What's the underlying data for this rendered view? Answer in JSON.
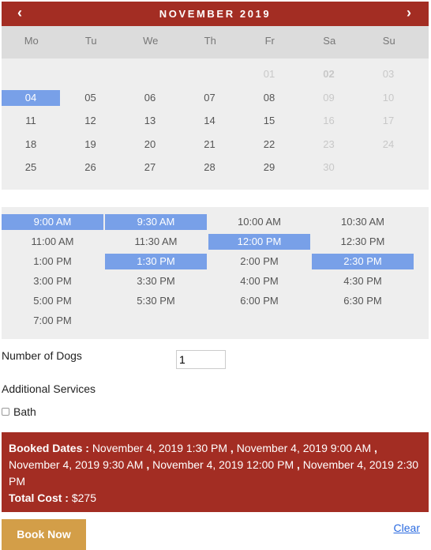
{
  "calendar": {
    "title": "NOVEMBER 2019",
    "prev_icon": "‹",
    "next_icon": "›",
    "weekdays": [
      "Mo",
      "Tu",
      "We",
      "Th",
      "Fr",
      "Sa",
      "Su"
    ],
    "days": [
      {
        "label": "01",
        "col": 4,
        "row": 0,
        "state": "disabled"
      },
      {
        "label": "02",
        "col": 5,
        "row": 0,
        "state": "disabled-bold"
      },
      {
        "label": "03",
        "col": 6,
        "row": 0,
        "state": "disabled"
      },
      {
        "label": "04",
        "col": 0,
        "row": 1,
        "state": "selected"
      },
      {
        "label": "05",
        "col": 1,
        "row": 1,
        "state": "normal"
      },
      {
        "label": "06",
        "col": 2,
        "row": 1,
        "state": "normal"
      },
      {
        "label": "07",
        "col": 3,
        "row": 1,
        "state": "normal"
      },
      {
        "label": "08",
        "col": 4,
        "row": 1,
        "state": "normal"
      },
      {
        "label": "09",
        "col": 5,
        "row": 1,
        "state": "disabled"
      },
      {
        "label": "10",
        "col": 6,
        "row": 1,
        "state": "disabled"
      },
      {
        "label": "11",
        "col": 0,
        "row": 2,
        "state": "normal"
      },
      {
        "label": "12",
        "col": 1,
        "row": 2,
        "state": "normal"
      },
      {
        "label": "13",
        "col": 2,
        "row": 2,
        "state": "normal"
      },
      {
        "label": "14",
        "col": 3,
        "row": 2,
        "state": "normal"
      },
      {
        "label": "15",
        "col": 4,
        "row": 2,
        "state": "normal"
      },
      {
        "label": "16",
        "col": 5,
        "row": 2,
        "state": "disabled"
      },
      {
        "label": "17",
        "col": 6,
        "row": 2,
        "state": "disabled"
      },
      {
        "label": "18",
        "col": 0,
        "row": 3,
        "state": "normal"
      },
      {
        "label": "19",
        "col": 1,
        "row": 3,
        "state": "normal"
      },
      {
        "label": "20",
        "col": 2,
        "row": 3,
        "state": "normal"
      },
      {
        "label": "21",
        "col": 3,
        "row": 3,
        "state": "normal"
      },
      {
        "label": "22",
        "col": 4,
        "row": 3,
        "state": "normal"
      },
      {
        "label": "23",
        "col": 5,
        "row": 3,
        "state": "disabled"
      },
      {
        "label": "24",
        "col": 6,
        "row": 3,
        "state": "disabled"
      },
      {
        "label": "25",
        "col": 0,
        "row": 4,
        "state": "normal"
      },
      {
        "label": "26",
        "col": 1,
        "row": 4,
        "state": "normal"
      },
      {
        "label": "27",
        "col": 2,
        "row": 4,
        "state": "normal"
      },
      {
        "label": "28",
        "col": 3,
        "row": 4,
        "state": "normal"
      },
      {
        "label": "29",
        "col": 4,
        "row": 4,
        "state": "normal"
      },
      {
        "label": "30",
        "col": 5,
        "row": 4,
        "state": "disabled"
      }
    ]
  },
  "time_slots": [
    {
      "label": "9:00 AM",
      "selected": true
    },
    {
      "label": "9:30 AM",
      "selected": true
    },
    {
      "label": "10:00 AM",
      "selected": false
    },
    {
      "label": "10:30 AM",
      "selected": false
    },
    {
      "label": "11:00 AM",
      "selected": false
    },
    {
      "label": "11:30 AM",
      "selected": false
    },
    {
      "label": "12:00 PM",
      "selected": true
    },
    {
      "label": "12:30 PM",
      "selected": false
    },
    {
      "label": "1:00 PM",
      "selected": false
    },
    {
      "label": "1:30 PM",
      "selected": true
    },
    {
      "label": "2:00 PM",
      "selected": false
    },
    {
      "label": "2:30 PM",
      "selected": true
    },
    {
      "label": "3:00 PM",
      "selected": false
    },
    {
      "label": "3:30 PM",
      "selected": false
    },
    {
      "label": "4:00 PM",
      "selected": false
    },
    {
      "label": "4:30 PM",
      "selected": false
    },
    {
      "label": "5:00 PM",
      "selected": false
    },
    {
      "label": "5:30 PM",
      "selected": false
    },
    {
      "label": "6:00 PM",
      "selected": false
    },
    {
      "label": "6:30 PM",
      "selected": false
    },
    {
      "label": "7:00 PM",
      "selected": false
    }
  ],
  "form": {
    "dogs_label": "Number of Dogs",
    "dogs_value": "1",
    "services_label": "Additional Services",
    "bath_label": "Bath",
    "bath_checked": false
  },
  "summary": {
    "booked_label": "Booked Dates :",
    "booked_dates": [
      "November 4, 2019 1:30 PM",
      "November 4, 2019 9:00 AM",
      "November 4, 2019 9:30 AM",
      "November 4, 2019 12:00 PM",
      "November 4, 2019 2:30 PM"
    ],
    "total_label": "Total Cost :",
    "total_value": "$275"
  },
  "actions": {
    "book_label": "Book Now",
    "clear_label": "Clear"
  },
  "colors": {
    "header": "#a32d23",
    "selected": "#78a0e8",
    "book_button": "#d39e48",
    "link": "#2a6ae0"
  }
}
